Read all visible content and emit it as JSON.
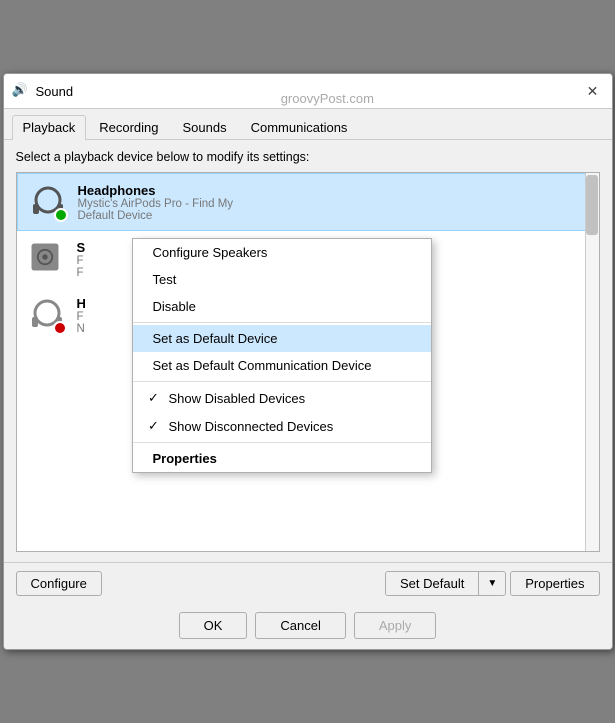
{
  "title_bar": {
    "icon": "🔊",
    "title": "Sound",
    "watermark": "groovyPost.com",
    "close_label": "✕"
  },
  "tabs": [
    {
      "id": "playback",
      "label": "Playback",
      "active": true
    },
    {
      "id": "recording",
      "label": "Recording",
      "active": false
    },
    {
      "id": "sounds",
      "label": "Sounds",
      "active": false
    },
    {
      "id": "communications",
      "label": "Communications",
      "active": false
    }
  ],
  "instruction": "Select a playback device below to modify its settings:",
  "devices": [
    {
      "id": "headphones",
      "name": "Headphones",
      "sub1": "Mystic's AirPods Pro - Find My",
      "sub2": "Default Device",
      "status": "green",
      "selected": true
    },
    {
      "id": "speaker",
      "name": "S",
      "sub1": "F",
      "sub2": "F",
      "status": "none",
      "selected": false
    },
    {
      "id": "headphones2",
      "name": "H",
      "sub1": "F",
      "sub2": "N",
      "status": "red",
      "selected": false
    }
  ],
  "context_menu": {
    "items": [
      {
        "id": "configure",
        "label": "Configure Speakers",
        "type": "normal"
      },
      {
        "id": "test",
        "label": "Test",
        "type": "normal"
      },
      {
        "id": "disable",
        "label": "Disable",
        "type": "normal"
      },
      {
        "id": "set-default",
        "label": "Set as Default Device",
        "type": "highlighted"
      },
      {
        "id": "set-default-comm",
        "label": "Set as Default Communication Device",
        "type": "normal"
      },
      {
        "id": "show-disabled",
        "label": "Show Disabled Devices",
        "type": "checked"
      },
      {
        "id": "show-disconnected",
        "label": "Show Disconnected Devices",
        "type": "checked"
      },
      {
        "id": "properties",
        "label": "Properties",
        "type": "bold"
      }
    ]
  },
  "bottom_buttons": {
    "configure": "Configure",
    "set_default": "Set Default",
    "properties": "Properties"
  },
  "ok_cancel": {
    "ok": "OK",
    "cancel": "Cancel",
    "apply": "Apply"
  }
}
